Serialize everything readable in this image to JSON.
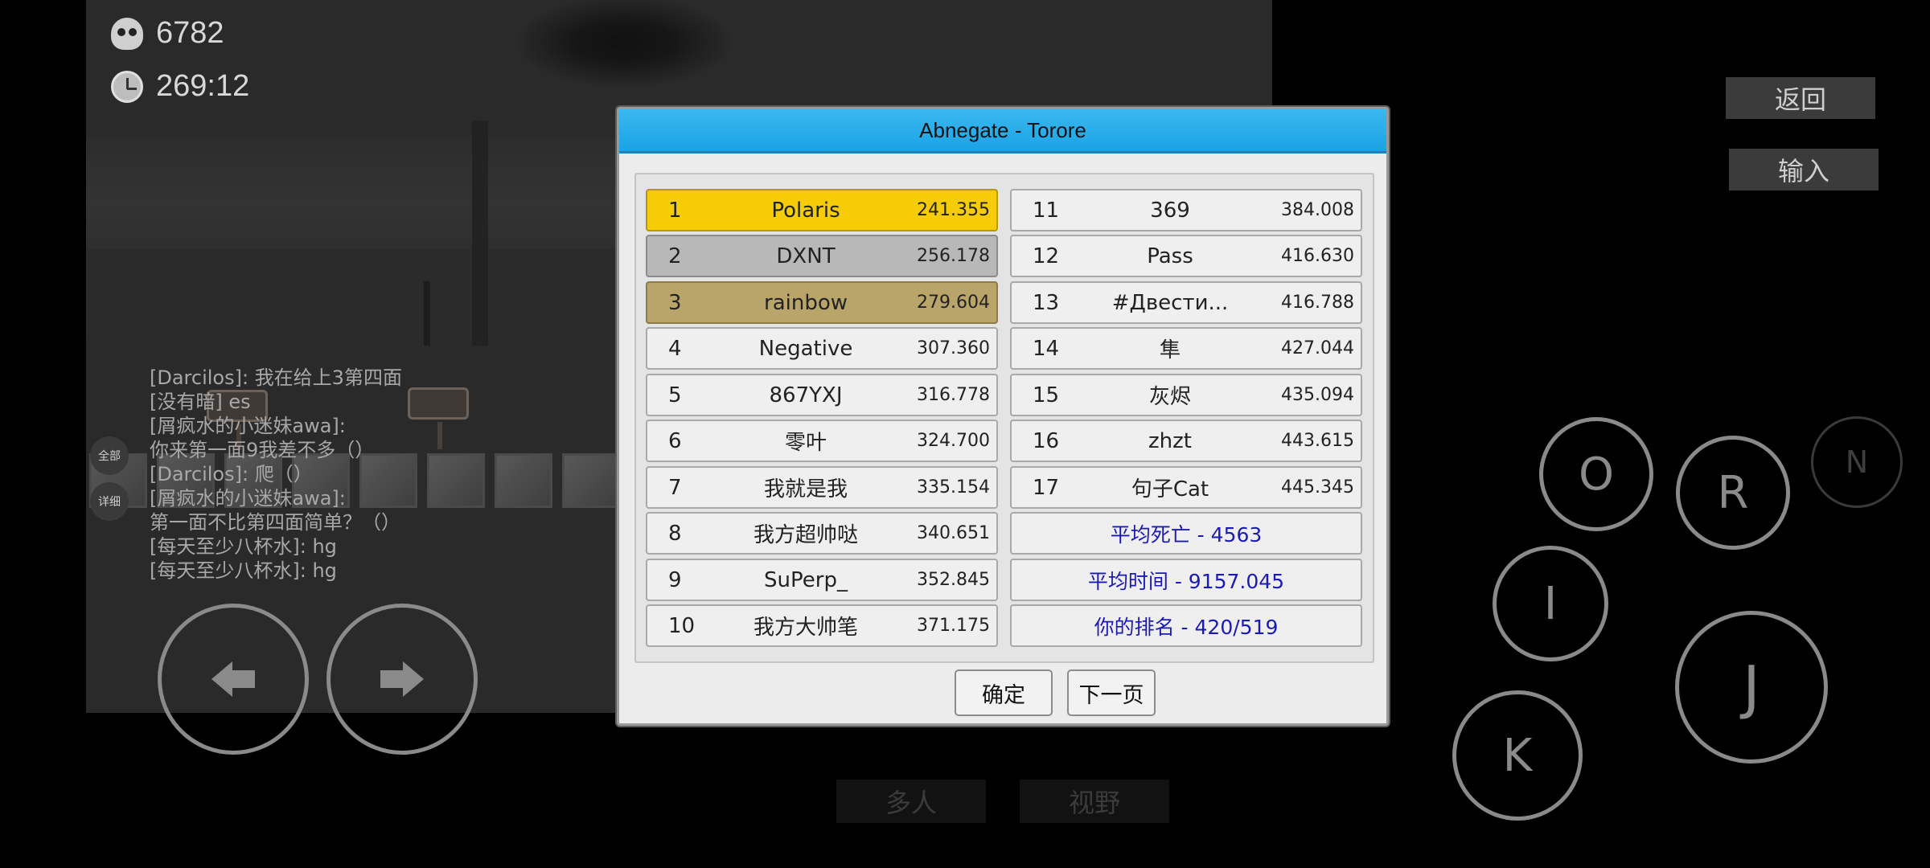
{
  "hud": {
    "deaths": "6782",
    "time": "269:12"
  },
  "chat": {
    "tab_all": "全部",
    "tab_detail": "详细",
    "lines": [
      "[Darcilos]: 我在给上3第四面",
      "[没有暗] es",
      "[屑疯水的小迷妹awa]:",
      "你来第一面9我差不多（）",
      "[Darcilos]: 爬（）",
      "[屑疯水的小迷妹awa]:",
      "第一面不比第四面简单？（）",
      "[每天至少八杯水]: hg",
      "[每天至少八杯水]: hg"
    ]
  },
  "side": {
    "back": "返回",
    "input": "输入",
    "multiplayer": "多人",
    "view": "视野"
  },
  "keys": {
    "o": "O",
    "r": "R",
    "n": "N",
    "i": "I",
    "j": "J",
    "k": "K"
  },
  "dialog": {
    "title": "Abnegate - Torore",
    "left": [
      {
        "rank": "1",
        "name": "Polaris",
        "time": "241.355"
      },
      {
        "rank": "2",
        "name": "DXNT",
        "time": "256.178"
      },
      {
        "rank": "3",
        "name": "rainbow",
        "time": "279.604"
      },
      {
        "rank": "4",
        "name": "Negative",
        "time": "307.360"
      },
      {
        "rank": "5",
        "name": "867YXJ",
        "time": "316.778"
      },
      {
        "rank": "6",
        "name": "零叶",
        "time": "324.700"
      },
      {
        "rank": "7",
        "name": "我就是我",
        "time": "335.154"
      },
      {
        "rank": "8",
        "name": "我方超帅哒",
        "time": "340.651"
      },
      {
        "rank": "9",
        "name": "SuPerp_",
        "time": "352.845"
      },
      {
        "rank": "10",
        "name": "我方大帅笔",
        "time": "371.175"
      }
    ],
    "right": [
      {
        "rank": "11",
        "name": "369",
        "time": "384.008"
      },
      {
        "rank": "12",
        "name": "Pass",
        "time": "416.630"
      },
      {
        "rank": "13",
        "name": "#Двести...",
        "time": "416.788"
      },
      {
        "rank": "14",
        "name": "隼",
        "time": "427.044"
      },
      {
        "rank": "15",
        "name": "灰烬",
        "time": "435.094"
      },
      {
        "rank": "16",
        "name": "zhzt",
        "time": "443.615"
      },
      {
        "rank": "17",
        "name": "句子Cat",
        "time": "445.345"
      }
    ],
    "stats": {
      "avg_deaths": "平均死亡 - 4563",
      "avg_time": "平均时间 - 9157.045",
      "your_rank": "你的排名 - 420/519"
    },
    "ok": "确定",
    "next": "下一页"
  }
}
